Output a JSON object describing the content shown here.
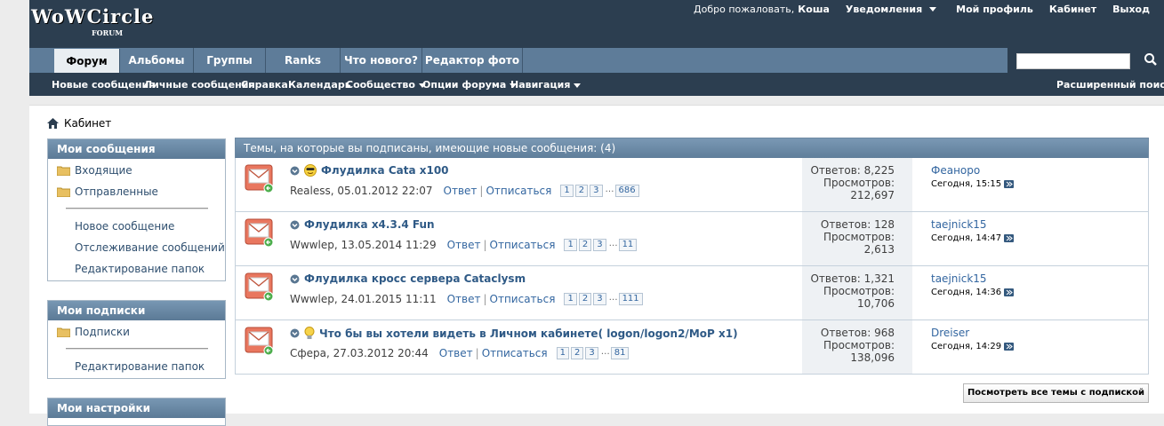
{
  "header": {
    "logo_main": "WoWCircle",
    "logo_sub": "FORUM",
    "welcome": "Добро пожаловать,",
    "username": "Коша",
    "notifications": "Уведомления",
    "my_profile": "Мой профиль",
    "cabinet": "Кабинет",
    "logout": "Выход"
  },
  "tabs": [
    "Форум",
    "Альбомы",
    "Группы",
    "Ranks",
    "Что нового?",
    "Редактор фото"
  ],
  "subnav": {
    "items": [
      "Новые сообщения",
      "Личные сообщения",
      "Справка",
      "Календарь",
      "Сообщество",
      "Опции форума",
      "Навигация"
    ],
    "advanced_search": "Расширенный поиск"
  },
  "search": {
    "placeholder": ""
  },
  "breadcrumb": "Кабинет",
  "sidebar": {
    "messages_title": "Мои сообщения",
    "inbox": "Входящие",
    "sent": "Отправленные",
    "new_message": "Новое сообщение",
    "tracking": "Отслеживание сообщений",
    "edit_folders": "Редактирование папок",
    "subs_title": "Мои подписки",
    "subscriptions": "Подписки",
    "subs_edit_folders": "Редактирование папок",
    "settings_title": "Мои настройки"
  },
  "main": {
    "heading": "Темы, на которые вы подписаны, имеющие новые сообщения: (4)",
    "reply_label": "Ответ",
    "unsubscribe_label": "Отписаться",
    "replies_label": "Ответов:",
    "views_label": "Просмотров:",
    "view_all": "Посмотреть все темы с подпиской",
    "threads": [
      {
        "title": "Флудилка Cata x100",
        "prefix": "cool-smiley-icon",
        "author": "Realess",
        "date": "05.01.2012 22:07",
        "pages": [
          "1",
          "2",
          "3"
        ],
        "last_page": "686",
        "replies": "8,225",
        "views": "212,697",
        "last_user": "Феаноро",
        "last_time": "Сегодня, 15:15"
      },
      {
        "title": "Флудилка x4.3.4 Fun",
        "prefix": "",
        "author": "Wwwlep",
        "date": "13.05.2014 11:29",
        "pages": [
          "1",
          "2",
          "3"
        ],
        "last_page": "11",
        "replies": "128",
        "views": "2,613",
        "last_user": "taejnick15",
        "last_time": "Сегодня, 14:47"
      },
      {
        "title": "Флудилка кросс сервера Cataclysm",
        "prefix": "",
        "author": "Wwwlep",
        "date": "24.01.2015 11:11",
        "pages": [
          "1",
          "2",
          "3"
        ],
        "last_page": "111",
        "replies": "1,321",
        "views": "10,706",
        "last_user": "taejnick15",
        "last_time": "Сегодня, 14:36"
      },
      {
        "title": "Что бы вы хотели видеть в Личном кабинете( logon/logon2/MoP x1)",
        "prefix": "lightbulb-icon",
        "author": "Сфера",
        "date": "27.03.2012 20:44",
        "pages": [
          "1",
          "2",
          "3"
        ],
        "last_page": "81",
        "replies": "968",
        "views": "138,096",
        "last_user": "Dreiser",
        "last_time": "Сегодня, 14:29"
      }
    ]
  },
  "colors": {
    "header_bg": "#2c3e50",
    "tabbar_bg": "#5e7c99",
    "link": "#3366a0"
  }
}
